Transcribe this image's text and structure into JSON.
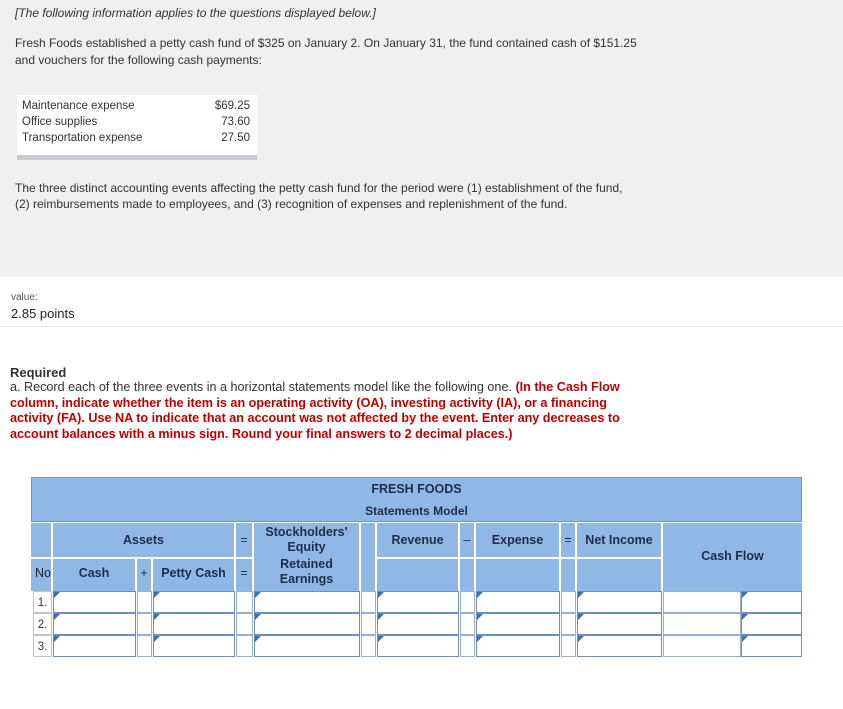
{
  "info": {
    "heading": "[The following information applies to the questions displayed below.]",
    "intro": "Fresh Foods established a petty cash fund of $325 on January 2. On January 31, the fund contained cash of $151.25 and vouchers for the following cash payments:",
    "payments": [
      {
        "label": "Maintenance expense",
        "amount": "$69.25"
      },
      {
        "label": "Office supplies",
        "amount": "73.60"
      },
      {
        "label": "Transportation expense",
        "amount": "27.50"
      }
    ],
    "events": "The three distinct accounting events affecting the petty cash fund for the period were (1) establishment of the fund, (2) reimbursements made to employees, and (3) recognition of expenses and replenishment of the fund."
  },
  "value": {
    "label": "value:",
    "points": "2.85 points"
  },
  "required": {
    "title": "Required",
    "text_plain": "a. Record each of the three events in a horizontal statements model like the following one.",
    "text_red": "(In the Cash Flow column, indicate whether the item is an operating activity (OA), investing activity (IA), or a financing activity (FA). Use NA to indicate that an account was not affected by the event. Enter any decreases to account balances with a minus sign. Round your final answers to 2 decimal places.)"
  },
  "model": {
    "company": "FRESH FOODS",
    "subtitle": "Statements Model",
    "assets": "Assets",
    "equals": "=",
    "minus": "–",
    "plus": "+",
    "equity": "Stockholders' Equity",
    "retained": "Retained Earnings",
    "revenue": "Revenue",
    "expense": "Expense",
    "net_income": "Net Income",
    "cash_flow": "Cash Flow",
    "no": "No",
    "cash": "Cash",
    "petty_cash": "Petty Cash",
    "rows": [
      "1.",
      "2.",
      "3."
    ]
  }
}
